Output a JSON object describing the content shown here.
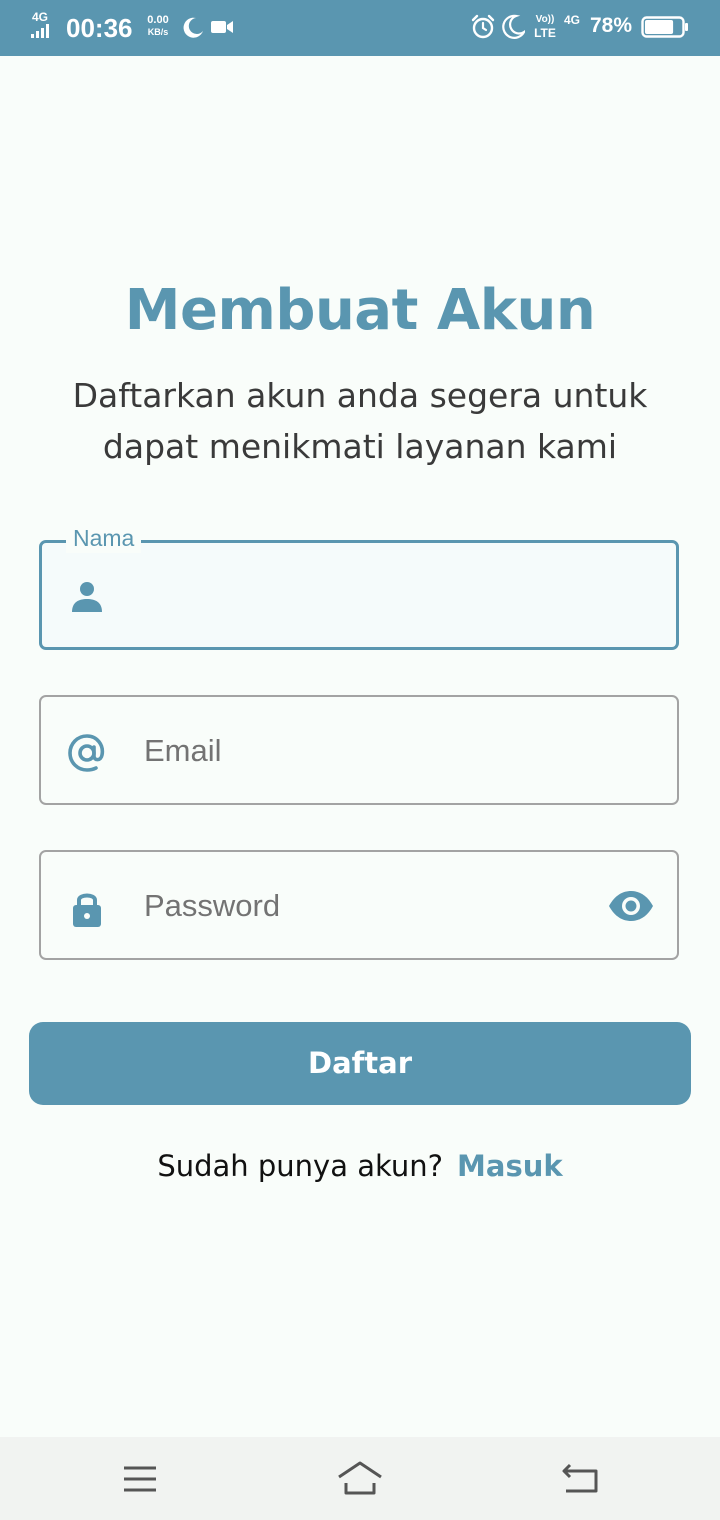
{
  "status_bar": {
    "network": "4G",
    "time": "00:36",
    "speed_value": "0.00",
    "speed_unit": "KB/s",
    "volte_top": "Vo))",
    "volte_bottom": "LTE",
    "network_right": "4G",
    "battery_percent": "78%",
    "battery_level": 0.78,
    "icons": [
      "signal-icon",
      "moon-icon",
      "video-camera-icon",
      "alarm-icon",
      "moon-icon",
      "battery-icon"
    ]
  },
  "header": {
    "title": "Membuat Akun",
    "subtitle": "Daftarkan akun anda segera untuk dapat menikmati layanan kami"
  },
  "form": {
    "name_field": {
      "label": "Nama",
      "value": "",
      "icon": "person-icon"
    },
    "email_field": {
      "placeholder": "Email",
      "icon": "at-icon"
    },
    "password_field": {
      "placeholder": "Password",
      "icon": "lock-icon",
      "toggle_icon": "eye-icon"
    },
    "submit_label": "Daftar"
  },
  "footer": {
    "question": "Sudah punya akun?",
    "link_label": "Masuk"
  },
  "nav_bar": {
    "icons": [
      "menu-icon",
      "home-icon",
      "back-icon"
    ]
  },
  "colors": {
    "accent": "#5a96b0",
    "background": "#f9fdfa",
    "text": "#3a3a3a",
    "border": "#a3a3a3"
  }
}
